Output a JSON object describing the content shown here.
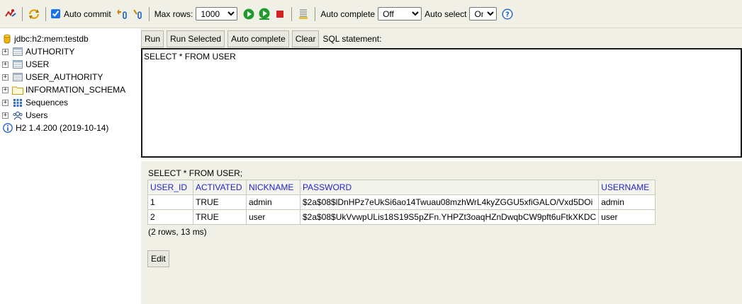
{
  "toolbar": {
    "auto_commit_label": "Auto commit",
    "auto_commit_checked": true,
    "max_rows_label": "Max rows:",
    "max_rows_value": "1000",
    "auto_complete_label": "Auto complete",
    "auto_complete_value": "Off",
    "auto_select_label": "Auto select",
    "auto_select_value": "On",
    "help_glyph": "?"
  },
  "tree": {
    "connection": "jdbc:h2:mem:testdb",
    "items": [
      {
        "label": "AUTHORITY",
        "icon": "table-icon"
      },
      {
        "label": "USER",
        "icon": "table-icon"
      },
      {
        "label": "USER_AUTHORITY",
        "icon": "table-icon"
      },
      {
        "label": "INFORMATION_SCHEMA",
        "icon": "folder-icon"
      },
      {
        "label": "Sequences",
        "icon": "sequences-icon"
      },
      {
        "label": "Users",
        "icon": "users-icon"
      }
    ],
    "version": "H2 1.4.200 (2019-10-14)"
  },
  "query": {
    "run_label": "Run",
    "run_selected_label": "Run Selected",
    "auto_complete_label": "Auto complete",
    "clear_label": "Clear",
    "statement_label": "SQL statement:",
    "sql_text": "SELECT * FROM USER"
  },
  "result": {
    "sql": "SELECT * FROM USER;",
    "columns": [
      "USER_ID",
      "ACTIVATED",
      "NICKNAME",
      "PASSWORD",
      "USERNAME"
    ],
    "rows": [
      [
        "1",
        "TRUE",
        "admin",
        "$2a$08$lDnHPz7eUkSi6ao14Twuau08mzhWrL4kyZGGU5xfiGALO/Vxd5DOi",
        "admin"
      ],
      [
        "2",
        "TRUE",
        "user",
        "$2a$08$UkVvwpULis18S19S5pZFn.YHPZt3oaqHZnDwqbCW9pft6uFtkXKDC",
        "user"
      ]
    ],
    "summary": "(2 rows, 13 ms)",
    "edit_label": "Edit"
  }
}
